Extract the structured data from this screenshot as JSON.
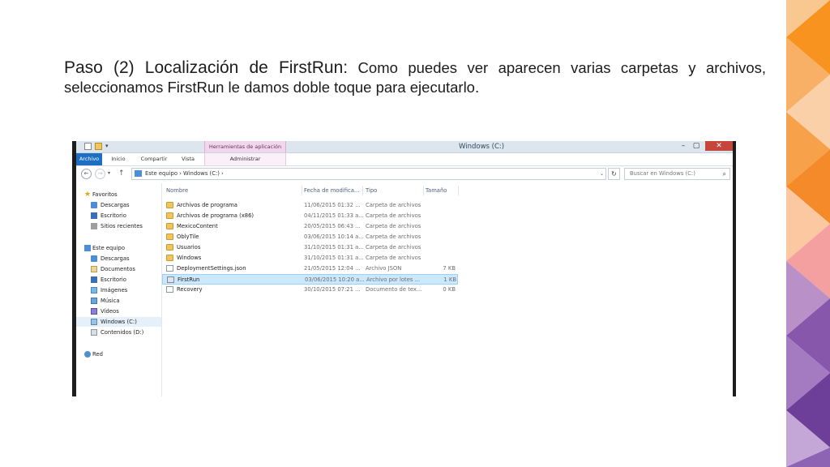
{
  "slide": {
    "heading": "Paso (2) Localización de FirstRun:",
    "body": " Como puedes ver aparecen varias carpetas y archivos, seleccionamos FirstRun  le damos doble toque para ejecutarlo."
  },
  "window": {
    "title": "Windows (C:)",
    "context_tab": "Herramientas de aplicación",
    "controls": {
      "minimize": "–",
      "maximize": "▢",
      "close": "✕"
    }
  },
  "ribbon": {
    "tabs": [
      "Archivo",
      "Inicio",
      "Compartir",
      "Vista",
      "Administrar"
    ]
  },
  "address": {
    "path": "Este equipo  ›  Windows (C:)  ›",
    "search_placeholder": "Buscar en Windows (C:)"
  },
  "nav_pane": {
    "favorites": {
      "label": "Favoritos",
      "items": [
        "Descargas",
        "Escritorio",
        "Sitios recientes"
      ]
    },
    "this_pc": {
      "label": "Este equipo",
      "items": [
        "Descargas",
        "Documentos",
        "Escritorio",
        "Imágenes",
        "Música",
        "Vídeos",
        "Windows (C:)",
        "Contenidos (D:)"
      ]
    },
    "network": {
      "label": "Red"
    }
  },
  "columns": [
    "Nombre",
    "Fecha de modifica...",
    "Tipo",
    "Tamaño"
  ],
  "files": [
    {
      "name": "Archivos de programa",
      "date": "11/06/2015 01:32 ...",
      "type": "Carpeta de archivos",
      "size": "",
      "kind": "folder"
    },
    {
      "name": "Archivos de programa (x86)",
      "date": "04/11/2015 01:33 a...",
      "type": "Carpeta de archivos",
      "size": "",
      "kind": "folder"
    },
    {
      "name": "MexicoContent",
      "date": "20/05/2015 06:43 ...",
      "type": "Carpeta de archivos",
      "size": "",
      "kind": "folder"
    },
    {
      "name": "OblyTile",
      "date": "03/06/2015 10:14 a...",
      "type": "Carpeta de archivos",
      "size": "",
      "kind": "folder"
    },
    {
      "name": "Usuarios",
      "date": "31/10/2015 01:31 a...",
      "type": "Carpeta de archivos",
      "size": "",
      "kind": "folder"
    },
    {
      "name": "Windows",
      "date": "31/10/2015 01:31 a...",
      "type": "Carpeta de archivos",
      "size": "",
      "kind": "folder"
    },
    {
      "name": "DeploymentSettings.json",
      "date": "21/05/2015 12:04 ...",
      "type": "Archivo JSON",
      "size": "7 KB",
      "kind": "file"
    },
    {
      "name": "FirstRun",
      "date": "03/06/2015 10:20 a...",
      "type": "Archivo por lotes ...",
      "size": "1 KB",
      "kind": "bat"
    },
    {
      "name": "Recovery",
      "date": "30/10/2015 07:21 ...",
      "type": "Documento de tex...",
      "size": "0 KB",
      "kind": "file"
    }
  ],
  "selected_file": "FirstRun",
  "colors": {
    "accent": "#1e6fc4",
    "selection": "#cce8ff",
    "context_tab": "#f2d6ee",
    "deco_orange": "#f7931e",
    "deco_purple": "#7a4fa5"
  }
}
